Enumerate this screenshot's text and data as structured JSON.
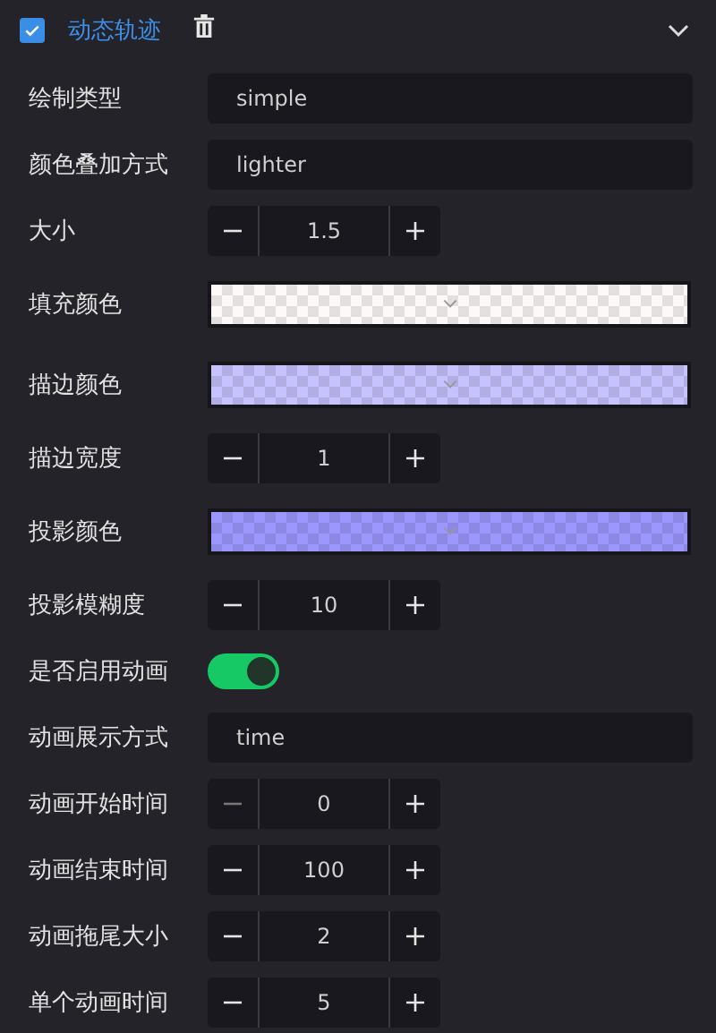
{
  "header": {
    "title": "动态轨迹",
    "checked": true,
    "expanded": true
  },
  "rows": [
    {
      "kind": "select",
      "label": "绘制类型",
      "value": "simple"
    },
    {
      "kind": "select",
      "label": "颜色叠加方式",
      "value": "lighter"
    },
    {
      "kind": "stepper",
      "label": "大小",
      "value": "1.5",
      "decrement_disabled": false
    },
    {
      "kind": "color",
      "label": "填充颜色",
      "color": "#fdf9f8"
    },
    {
      "kind": "color",
      "label": "描边颜色",
      "color": "#c6c2fd"
    },
    {
      "kind": "stepper",
      "label": "描边宽度",
      "value": "1",
      "decrement_disabled": false
    },
    {
      "kind": "color",
      "label": "投影颜色",
      "color": "#9c97fd"
    },
    {
      "kind": "stepper",
      "label": "投影模糊度",
      "value": "10",
      "decrement_disabled": false
    },
    {
      "kind": "switch",
      "label": "是否启用动画",
      "on": true
    },
    {
      "kind": "select",
      "label": "动画展示方式",
      "value": "time"
    },
    {
      "kind": "stepper",
      "label": "动画开始时间",
      "value": "0",
      "decrement_disabled": true
    },
    {
      "kind": "stepper",
      "label": "动画结束时间",
      "value": "100",
      "decrement_disabled": false
    },
    {
      "kind": "stepper",
      "label": "动画拖尾大小",
      "value": "2",
      "decrement_disabled": false
    },
    {
      "kind": "stepper",
      "label": "单个动画时间",
      "value": "5",
      "decrement_disabled": false
    }
  ]
}
